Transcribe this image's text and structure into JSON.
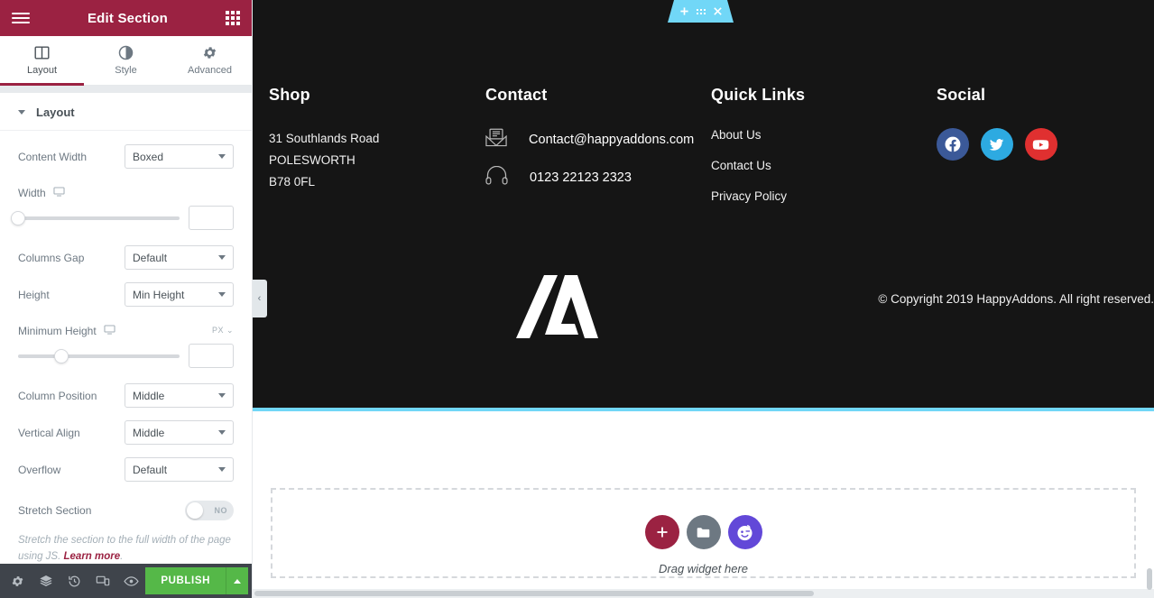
{
  "panel": {
    "header": {
      "title": "Edit Section",
      "menu_icon": "hamburger-icon",
      "apps_icon": "grid-apps-icon"
    },
    "tabs": [
      {
        "label": "Layout",
        "icon": "layout-columns-icon",
        "active": true
      },
      {
        "label": "Style",
        "icon": "contrast-circle-icon",
        "active": false
      },
      {
        "label": "Advanced",
        "icon": "gear-icon",
        "active": false
      }
    ],
    "section": {
      "title": "Layout",
      "collapsed": false
    },
    "controls": [
      {
        "name": "content-width",
        "label": "Content Width",
        "type": "select",
        "value": "Boxed"
      },
      {
        "name": "width",
        "label": "Width",
        "type": "slider",
        "device_icon": "desktop-icon",
        "value": "",
        "knob_percent": 0
      },
      {
        "name": "columns-gap",
        "label": "Columns Gap",
        "type": "select",
        "value": "Default"
      },
      {
        "name": "height",
        "label": "Height",
        "type": "select",
        "value": "Min Height"
      },
      {
        "name": "minimum-height",
        "label": "Minimum Height",
        "type": "slider",
        "device_icon": "desktop-icon",
        "unit": "PX",
        "value": "",
        "knob_percent": 27
      },
      {
        "name": "column-position",
        "label": "Column Position",
        "type": "select",
        "value": "Middle"
      },
      {
        "name": "vertical-align",
        "label": "Vertical Align",
        "type": "select",
        "value": "Middle"
      },
      {
        "name": "overflow",
        "label": "Overflow",
        "type": "select",
        "value": "Default"
      },
      {
        "name": "stretch-section",
        "label": "Stretch Section",
        "type": "toggle",
        "value": "NO"
      }
    ],
    "hint": {
      "text": "Stretch the section to the full width of the page using JS. ",
      "link": "Learn more",
      "suffix": "."
    },
    "footer": {
      "icons": [
        {
          "name": "settings-gear-icon"
        },
        {
          "name": "layers-navigator-icon"
        },
        {
          "name": "history-revisions-icon"
        },
        {
          "name": "responsive-mode-icon"
        },
        {
          "name": "preview-eye-icon"
        }
      ],
      "publish_label": "PUBLISH",
      "publish_arrow_icon": "caret-up-icon",
      "publish_color": "#55b848"
    },
    "collapse_icon": "chevron-left-icon"
  },
  "preview": {
    "section_toolbar": {
      "add_icon": "plus-icon",
      "handle_icon": "drag-handle-dots-icon",
      "close_icon": "close-x-icon",
      "color": "#71d7f7"
    },
    "footer": {
      "background": "#151515",
      "columns": [
        {
          "name": "shop",
          "heading": "Shop",
          "lines": [
            "31 Southlands Road",
            "POLESWORTH",
            "B78 0FL"
          ]
        },
        {
          "name": "contact",
          "heading": "Contact",
          "items": [
            {
              "icon": "envelope-icon",
              "text": "Contact@happyaddons.com"
            },
            {
              "icon": "headphones-icon",
              "text": "0123 22123 2323"
            }
          ]
        },
        {
          "name": "quick-links",
          "heading": "Quick Links",
          "links": [
            "About Us",
            "Contact Us",
            "Privacy Policy"
          ]
        },
        {
          "name": "social",
          "heading": "Social",
          "socials": [
            {
              "icon": "facebook-icon",
              "color": "#3b5998"
            },
            {
              "icon": "twitter-icon",
              "color": "#2daae1"
            },
            {
              "icon": "youtube-icon",
              "color": "#e03030"
            }
          ]
        }
      ],
      "logo_icon": "happyaddons-lambda-logo",
      "copyright": "© Copyright 2019 HappyAddons. All right reserved."
    },
    "dropzone": {
      "text": "Drag widget here",
      "buttons": [
        {
          "name": "add-section-button",
          "icon": "plus-icon",
          "color": "#9b2242"
        },
        {
          "name": "add-template-button",
          "icon": "folder-icon",
          "color": "#6d7882"
        },
        {
          "name": "happyaddons-button",
          "icon": "happy-face-icon",
          "color": "#6248d8"
        }
      ]
    }
  }
}
